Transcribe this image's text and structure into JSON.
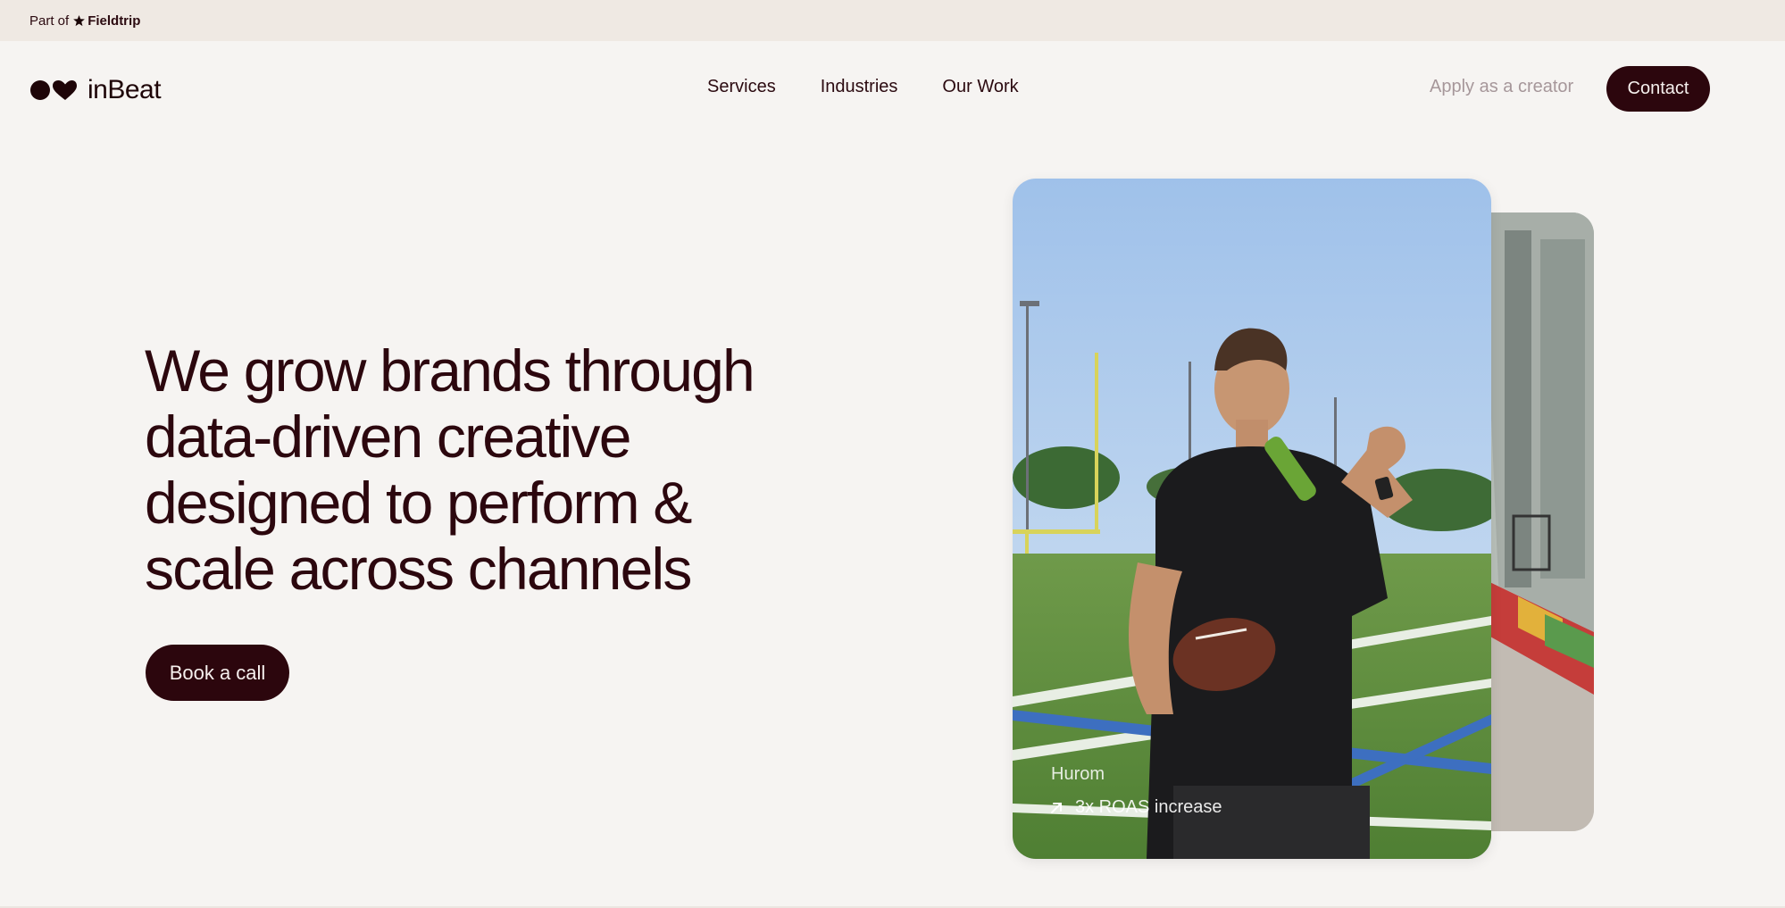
{
  "topbar": {
    "part_of": "Part of",
    "brand": "Fieldtrip"
  },
  "header": {
    "logo_text": "inBeat",
    "nav": [
      "Services",
      "Industries",
      "Our Work"
    ],
    "apply_label": "Apply as a creator",
    "contact_label": "Contact"
  },
  "hero": {
    "title": "We grow brands through data-driven creative designed to perform & scale across channels",
    "cta_label": "Book a call"
  },
  "case_card": {
    "brand": "Hurom",
    "stat": "3x ROAS increase",
    "image": "man-drinking-green-juice-holding-football-on-field"
  },
  "colors": {
    "background": "#f6f4f2",
    "topbar": "#efe9e3",
    "brand_dark": "#2c060d",
    "muted_link": "#a6979a"
  },
  "icons": [
    "fieldtrip-star-icon",
    "inbeat-logo-icon",
    "arrow-up-right-icon"
  ]
}
